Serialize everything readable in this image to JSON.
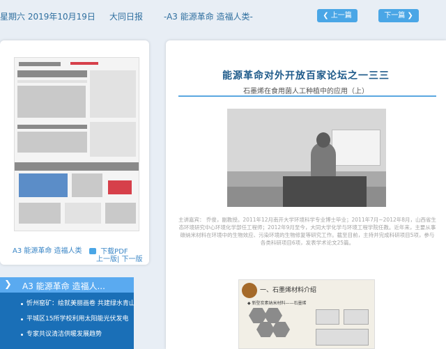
{
  "header": {
    "date": "星期六 2019年10月19日",
    "paper": "大同日报",
    "section": "-A3 能源革命 造福人类-",
    "prev_label": "上一篇",
    "next_label": "下一篇"
  },
  "page_panel": {
    "caption": "A3 能源革命 造福人类",
    "pdf_label": "下载PDF",
    "page_nav": "上一版| 下一版"
  },
  "article_list": {
    "heading": "A3  能源革命 造福人...",
    "items": [
      "忻州窑矿：绘就美丽画卷 共建绿水青山",
      "平城区15所学校利用太阳能光伏发电",
      "专家共议清洁供暖发展趋势"
    ]
  },
  "article": {
    "title": "能源革命对外开放百家论坛之一三三",
    "subtitle": "石墨烯在食用菌人工种植中的应用（上）",
    "intro": "主讲嘉宾： 乔俊，副教授。2011年12月南开大学环境科学专业博士毕业；2011年7月~2012年8月，山西省生态环境研究中心环境化学部任工程师；2012年9月至今，大同大学化学与环境工程学院任教。近年来，主要从事碳纳米材料在环境中的生物效应、污染环境的生物修复等研究工作。截至目前，主持并完成科研项目5项，参与各类科研项目6项，发表学术论文25篇。",
    "slide_heading": "一、石墨烯材料介绍",
    "slide_bullet": "◆ 新型炭素纳米材料——石墨烯"
  }
}
